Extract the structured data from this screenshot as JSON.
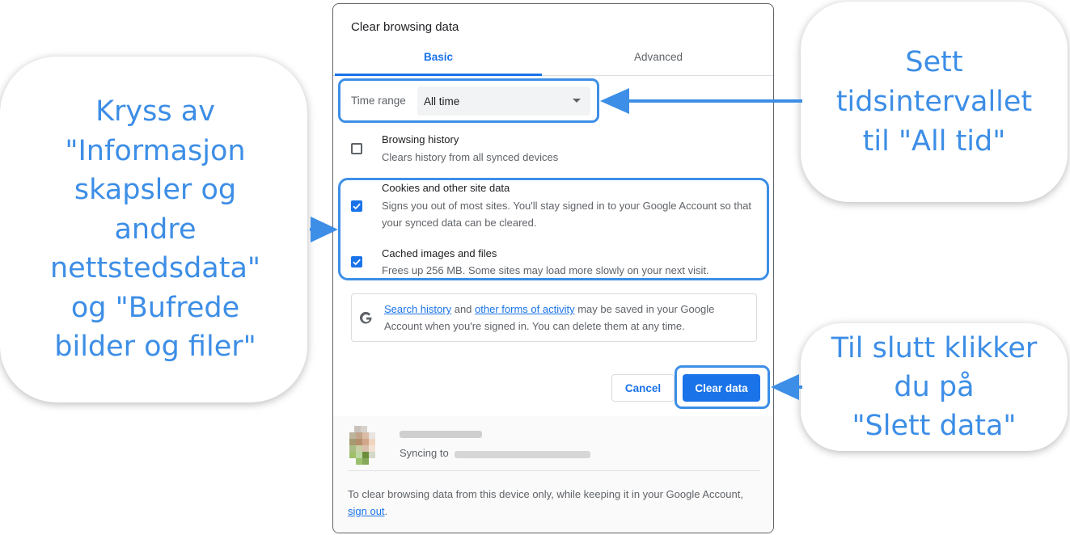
{
  "callouts": {
    "left": {
      "lines": [
        "Kryss av",
        "\"Informasjon",
        "skapsler og",
        "andre",
        "nettstedsdata\"",
        "og \"Bufrede",
        "bilder og filer\""
      ]
    },
    "top_right": {
      "lines": [
        "Sett",
        "tidsintervallet",
        "til \"All tid\""
      ]
    },
    "bottom_right": {
      "lines": [
        "Til slutt klikker",
        "du på",
        "\"Slett data\""
      ]
    }
  },
  "dialog": {
    "title": "Clear browsing data",
    "tabs": [
      {
        "label": "Basic",
        "active": true
      },
      {
        "label": "Advanced",
        "active": false
      }
    ],
    "time_range": {
      "label": "Time range",
      "value": "All time"
    },
    "items": [
      {
        "title": "Browsing history",
        "description": "Clears history from all synced devices",
        "checked": false
      },
      {
        "title": "Cookies and other site data",
        "description": "Signs you out of most sites. You'll stay signed in to your Google Account so that your synced data can be cleared.",
        "checked": true
      },
      {
        "title": "Cached images and files",
        "description": "Frees up 256 MB. Some sites may load more slowly on your next visit.",
        "checked": true
      }
    ],
    "info": {
      "link1": "Search history",
      "and": "and",
      "link2": "other forms of activity",
      "rest": "may be saved in your Google Account when you're signed in. You can delete them at any time."
    },
    "buttons": {
      "cancel": "Cancel",
      "clear": "Clear data"
    },
    "account": {
      "syncing_label": "Syncing to"
    },
    "footer": {
      "text": "To clear browsing data from this device only, while keeping it in your Google Account,",
      "link": "sign out",
      "end": "."
    }
  },
  "colors": {
    "accent": "#1a73e8",
    "annotation": "#3d8ee6"
  }
}
